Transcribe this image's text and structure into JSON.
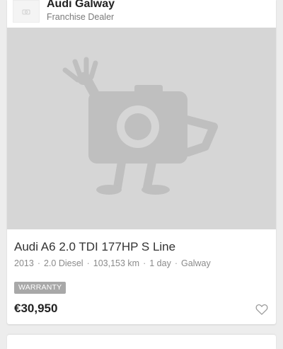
{
  "dealer": {
    "name": "Audi Galway",
    "type": "Franchise Dealer",
    "logo_icon": "camera-icon"
  },
  "listing": {
    "photo_icon": "camera-mascot-placeholder-icon",
    "title": "Audi A6 2.0 TDI 177HP S Line",
    "specs": [
      "2013",
      "2.0 Diesel",
      "103,153 km",
      "1 day",
      "Galway"
    ],
    "spec_separator": "·",
    "badge": "WARRANTY",
    "price": "€30,950",
    "favourite_icon": "heart-icon"
  },
  "colors": {
    "background": "#ededed",
    "placeholder": "#d6d6d6",
    "placeholder_icon": "#bfbfbf",
    "badge": "#a8a8a8"
  }
}
